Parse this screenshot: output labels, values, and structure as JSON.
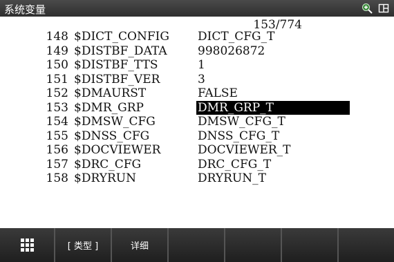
{
  "window": {
    "title": "系统变量",
    "icons": [
      "zoom-plus-icon",
      "split-window-icon"
    ]
  },
  "pager": "153/774",
  "rows": [
    {
      "index": "148",
      "name": "$DICT_CONFIG",
      "value": "DICT_CFG_T"
    },
    {
      "index": "149",
      "name": "$DISTBF_DATA",
      "value": "998026872"
    },
    {
      "index": "150",
      "name": "$DISTBF_TTS",
      "value": "1"
    },
    {
      "index": "151",
      "name": "$DISTBF_VER",
      "value": "3"
    },
    {
      "index": "152",
      "name": "$DMAURST",
      "value": "FALSE"
    },
    {
      "index": "153",
      "name": "$DMR_GRP",
      "value": "DMR_GRP_T",
      "selected": true
    },
    {
      "index": "154",
      "name": "$DMSW_CFG",
      "value": "DMSW_CFG_T"
    },
    {
      "index": "155",
      "name": "$DNSS_CFG",
      "value": "DNSS_CFG_T"
    },
    {
      "index": "156",
      "name": "$DOCVIEWER",
      "value": "DOCVIEWER_T"
    },
    {
      "index": "157",
      "name": "$DRC_CFG",
      "value": "DRC_CFG_T"
    },
    {
      "index": "158",
      "name": "$DRYRUN",
      "value": "DRYRUN_T"
    }
  ],
  "softkeys": {
    "menu_icon": "grid-menu-icon",
    "type_label": "[ 类型 ]",
    "detail_label": "详细",
    "k4": "",
    "k5": "",
    "k6": "",
    "k7": ""
  },
  "colors": {
    "titlebar": "#2e2e2e",
    "softkey_bar": "#1f1f1f",
    "selection": "#000000"
  }
}
